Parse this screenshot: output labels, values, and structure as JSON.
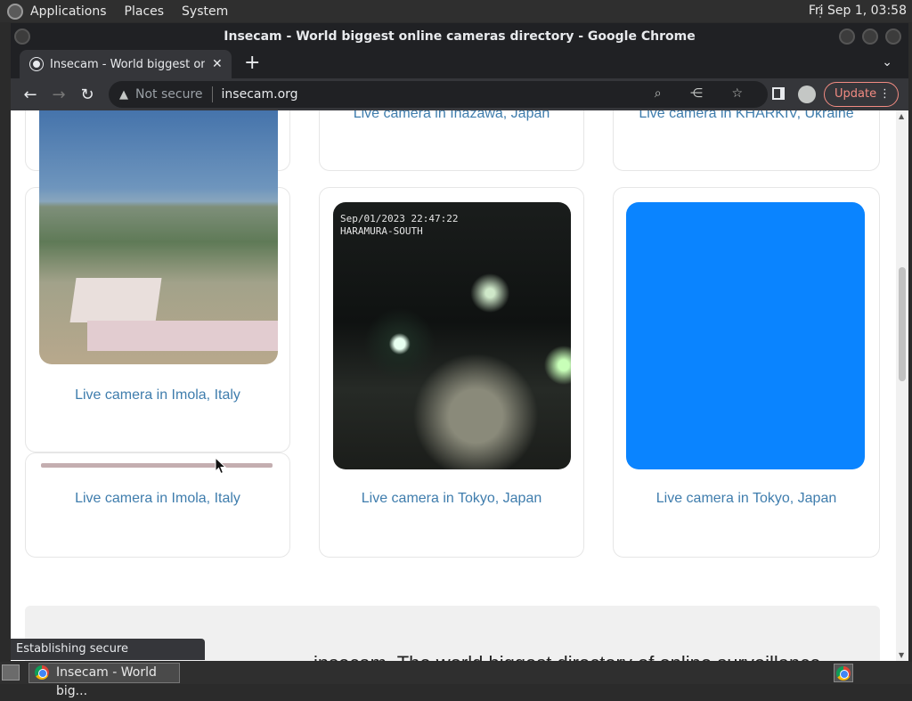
{
  "top_panel": {
    "menus": [
      "Applications",
      "Places",
      "System"
    ],
    "clock": "Fri Sep  1, 03:58"
  },
  "window": {
    "title": "Insecam - World biggest online cameras directory - Google Chrome"
  },
  "tabs": [
    {
      "title": "Insecam - World biggest online cameras directory",
      "close": "✕"
    }
  ],
  "new_tab_label": "+",
  "tab_menu": "⌄",
  "toolbar": {
    "back": "←",
    "forward": "→",
    "reload": "↻",
    "security_icon": "▲",
    "security_label": "Not secure",
    "url": "insecam.org",
    "omnibox_icons": "⌕ ⋲ ☆",
    "update_label": "Update",
    "menu_dots": "⋮"
  },
  "cards": [
    {
      "label": "Live camera in Inazawa, Japan"
    },
    {
      "label": "Live camera in KHARKIV, Ukraine"
    },
    {
      "label": "Live camera in Imola, Italy"
    },
    {
      "label": "Live camera in Imola, Italy"
    },
    {
      "label": "Live camera in Tokyo, Japan",
      "stamp": [
        "Sep/01/2023 22:47:22",
        "HARAMURA-SOUTH"
      ]
    },
    {
      "label": "Live camera in Tokyo, Japan"
    }
  ],
  "footer_text": "insecam. The world biggest directory of online surveillance",
  "status_bubble": "Establishing secure connection...",
  "taskbar": {
    "item_label": "Insecam - World big..."
  },
  "colors": {
    "link": "#3f7dad",
    "blue_feed": "#0a84ff",
    "update_accent": "#f28b82"
  }
}
